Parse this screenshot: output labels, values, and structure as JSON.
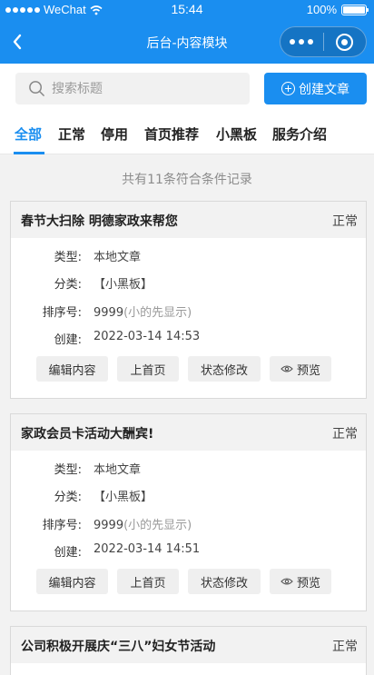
{
  "status_bar": {
    "carrier": "WeChat",
    "time": "15:44",
    "battery": "100%"
  },
  "nav": {
    "title": "后台-内容模块"
  },
  "search": {
    "placeholder": "搜索标题",
    "value": ""
  },
  "create_button": {
    "label": "创建文章"
  },
  "tabs": [
    {
      "label": "全部",
      "active": true
    },
    {
      "label": "正常"
    },
    {
      "label": "停用"
    },
    {
      "label": "首页推荐"
    },
    {
      "label": "小黑板"
    },
    {
      "label": "服务介绍"
    }
  ],
  "count_text": "共有11条符合条件记录",
  "field_labels": {
    "type": "类型:",
    "category": "分类:",
    "sort": "排序号:",
    "created": "创建:"
  },
  "buttons": {
    "edit": "编辑内容",
    "homepage": "上首页",
    "status": "状态修改",
    "preview": "预览"
  },
  "sort_hint": "(小的先显示)",
  "articles": [
    {
      "title": "春节大扫除 明德家政来帮您",
      "status": "正常",
      "type": "本地文章",
      "category": "【小黑板】",
      "sort": "9999",
      "created": "2022-03-14 14:53"
    },
    {
      "title": "家政会员卡活动大酬宾!",
      "status": "正常",
      "type": "本地文章",
      "category": "【小黑板】",
      "sort": "9999",
      "created": "2022-03-14 14:51"
    },
    {
      "title": "公司积极开展庆“三八”妇女节活动",
      "status": "正常"
    }
  ]
}
